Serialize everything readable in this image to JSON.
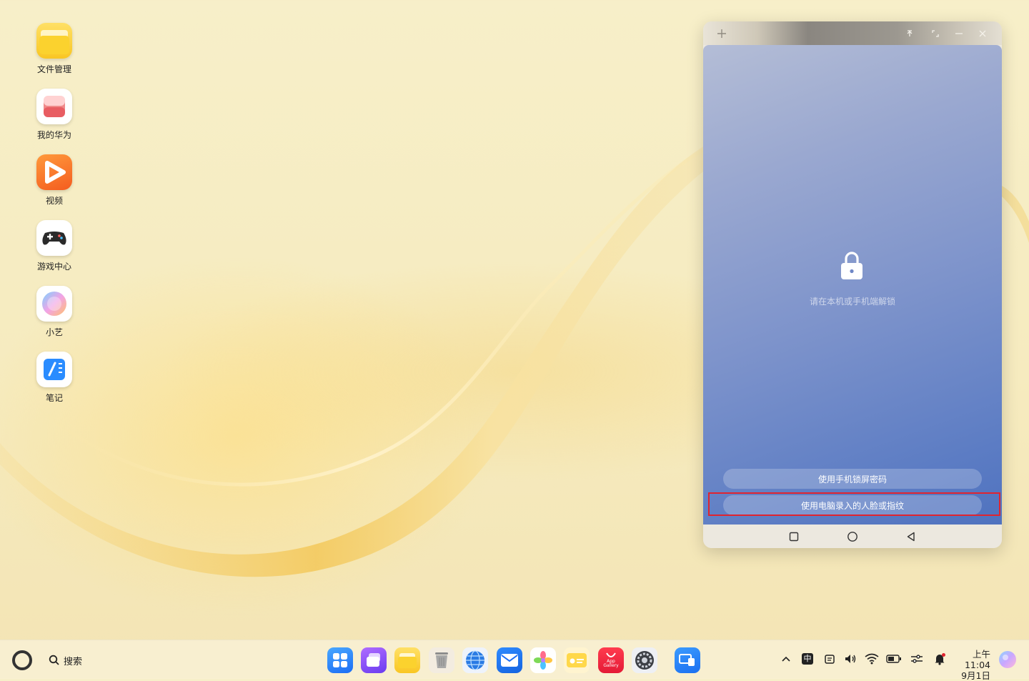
{
  "desktop": {
    "icons": [
      {
        "label": "文件管理",
        "icon": "folder-icon"
      },
      {
        "label": "我的华为",
        "icon": "my-huawei-icon"
      },
      {
        "label": "视频",
        "icon": "video-icon"
      },
      {
        "label": "游戏中心",
        "icon": "gamepad-icon"
      },
      {
        "label": "小艺",
        "icon": "xiaoyi-icon"
      },
      {
        "label": "笔记",
        "icon": "notes-icon"
      }
    ]
  },
  "phone_window": {
    "titlebar": {
      "new_tab_icon": "plus-icon",
      "pin_icon": "pin-icon",
      "fullscreen_icon": "fullscreen-icon",
      "minimize_icon": "minimize-icon",
      "close_icon": "close-icon"
    },
    "lock_screen": {
      "hint": "请在本机或手机端解锁",
      "button_phone_password": "使用手机锁屏密码",
      "button_face_fingerprint": "使用电脑录入的人脸或指纹"
    },
    "nav": [
      "recent-apps-icon",
      "home-icon",
      "back-icon"
    ],
    "highlight_color": "#e0242f"
  },
  "taskbar": {
    "search_label": "搜索",
    "dock_apps": [
      "app-launcher-icon",
      "multitask-icon",
      "files-icon",
      "trash-icon",
      "browser-icon",
      "mail-icon",
      "gallery-icon",
      "wallet-icon",
      "appgallery-icon",
      "settings-icon",
      "device-connect-icon"
    ],
    "appgallery_label": "App\nGallery",
    "tray": {
      "input_method": "中",
      "time": "上午11:04",
      "date": "9月1日"
    }
  }
}
